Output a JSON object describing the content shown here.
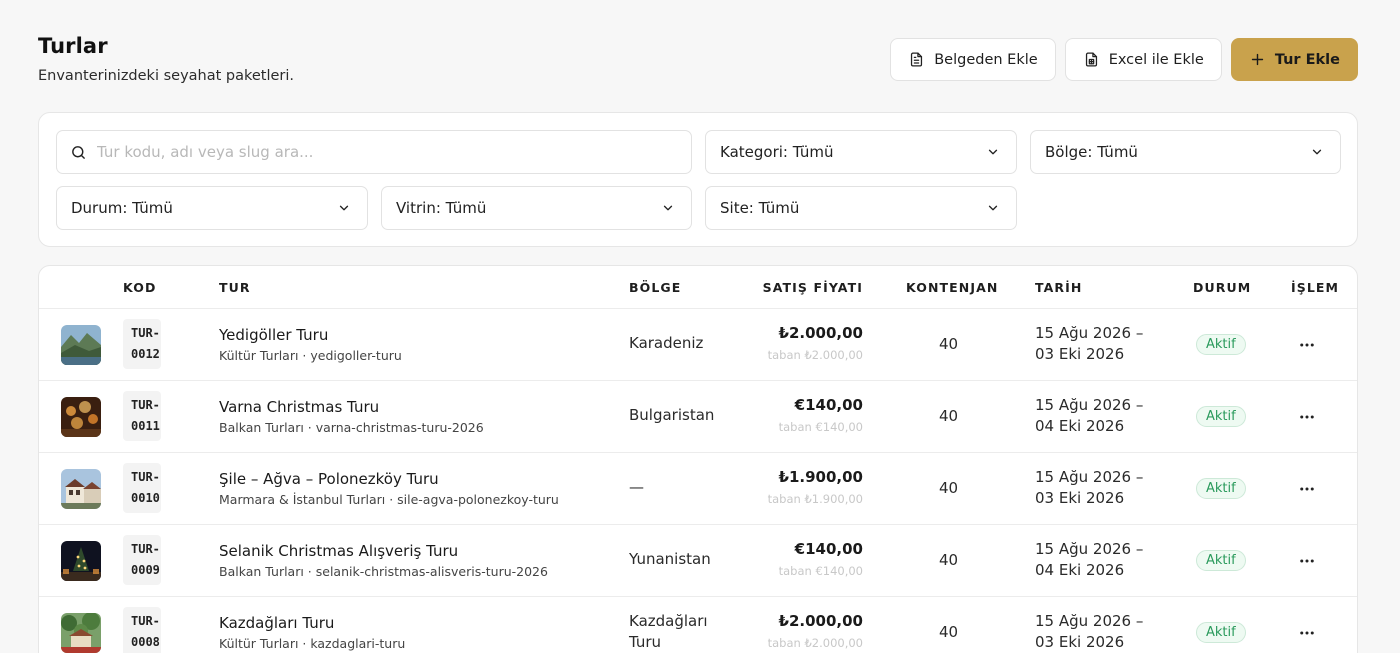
{
  "header": {
    "title": "Turlar",
    "subtitle": "Envanterinizdeki seyahat paketleri."
  },
  "actions": {
    "from_document": "Belgeden Ekle",
    "from_excel": "Excel ile Ekle",
    "add_tour": "Tur Ekle"
  },
  "filters": {
    "search_placeholder": "Tur kodu, adı veya slug ara...",
    "category": "Kategori: Tümü",
    "region": "Bölge: Tümü",
    "status": "Durum: Tümü",
    "showcase": "Vitrin: Tümü",
    "site": "Site: Tümü"
  },
  "table": {
    "columns": {
      "code": "KOD",
      "tour": "TUR",
      "region": "BÖLGE",
      "price": "SATIŞ FİYATI",
      "quota": "KONTENJAN",
      "date": "TARİH",
      "status": "DURUM",
      "action": "İŞLEM"
    },
    "rows": [
      {
        "code_a": "TUR-",
        "code_b": "0012",
        "name": "Yedigöller Turu",
        "meta": "Kültür Turları · yedigoller-turu",
        "region_a": "Karadeniz",
        "region_b": "",
        "price": "₺2.000,00",
        "base": "taban ₺2.000,00",
        "quota": "40",
        "date_start": "15 Ağu 2026 –",
        "date_end": "03 Eki 2026",
        "status": "Aktif",
        "thumb": "mountain-lake"
      },
      {
        "code_a": "TUR-",
        "code_b": "0011",
        "name": "Varna Christmas Turu",
        "meta": "Balkan Turları · varna-christmas-turu-2026",
        "region_a": "Bulgaristan",
        "region_b": "",
        "price": "€140,00",
        "base": "taban €140,00",
        "quota": "40",
        "date_start": "15 Ağu 2026 –",
        "date_end": "04 Eki 2026",
        "status": "Aktif",
        "thumb": "christmas-lights"
      },
      {
        "code_a": "TUR-",
        "code_b": "0010",
        "name": "Şile – Ağva – Polonezköy Turu",
        "meta": "Marmara & İstanbul Turları · sile-agva-polonezkoy-turu",
        "region_a": "—",
        "region_b": "",
        "price": "₺1.900,00",
        "base": "taban ₺1.900,00",
        "quota": "40",
        "date_start": "15 Ağu 2026 –",
        "date_end": "03 Eki 2026",
        "status": "Aktif",
        "thumb": "historic-houses"
      },
      {
        "code_a": "TUR-",
        "code_b": "0009",
        "name": "Selanik Christmas Alışveriş Turu",
        "meta": "Balkan Turları · selanik-christmas-alisveris-turu-2026",
        "region_a": "Yunanistan",
        "region_b": "",
        "price": "€140,00",
        "base": "taban €140,00",
        "quota": "40",
        "date_start": "15 Ağu 2026 –",
        "date_end": "04 Eki 2026",
        "status": "Aktif",
        "thumb": "night-tree"
      },
      {
        "code_a": "TUR-",
        "code_b": "0008",
        "name": "Kazdağları Turu",
        "meta": "Kültür Turları · kazdaglari-turu",
        "region_a": "Kazdağları",
        "region_b": "Turu",
        "price": "₺2.000,00",
        "base": "taban ₺2.000,00",
        "quota": "40",
        "date_start": "15 Ağu 2026 –",
        "date_end": "03 Eki 2026",
        "status": "Aktif",
        "thumb": "forest-village"
      }
    ]
  },
  "colors": {
    "accent": "#c9a24c",
    "status_green": "#2a9a5c"
  }
}
